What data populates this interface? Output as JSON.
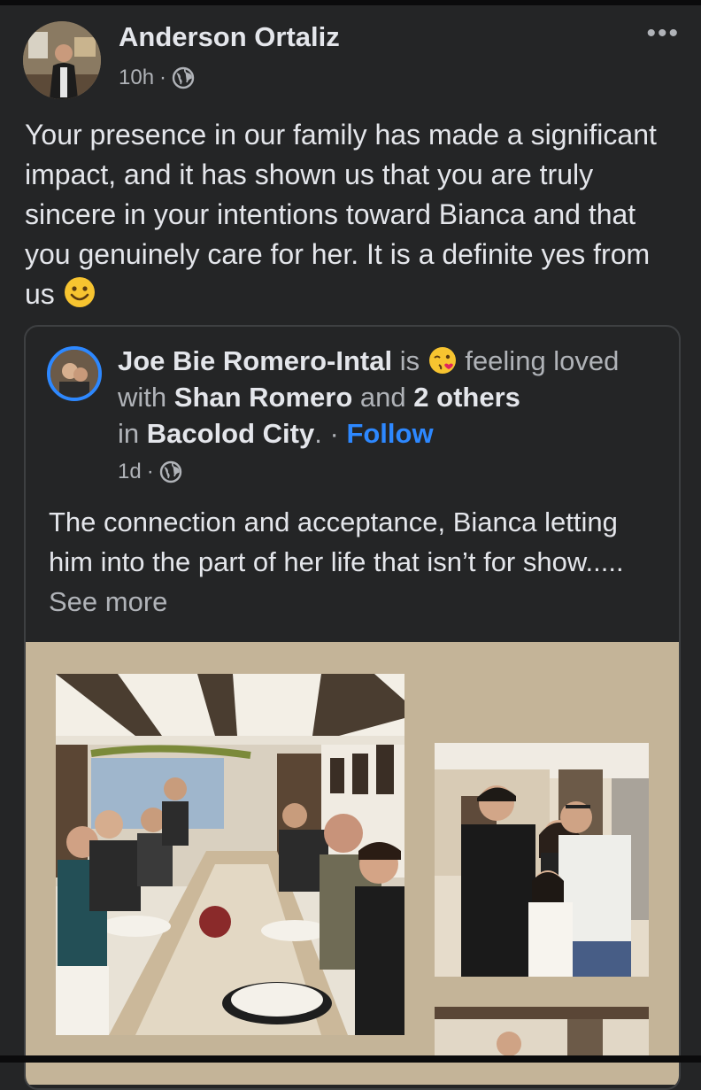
{
  "post": {
    "author": "Anderson Ortaliz",
    "time": "10h",
    "separator": "·",
    "more_label": "•••",
    "caption": "Your presence in our family has made a significant impact, and it has shown us that you are truly sincere in your intentions toward Bianca and that you genuinely care for her. It is a definite yes from us",
    "caption_emoji": "smiling-face-icon"
  },
  "shared": {
    "author": "Joe Bie Romero-Intal",
    "is_text": "is",
    "feeling_emoji": "face-blowing-kiss-icon",
    "feeling_text": "feeling loved with",
    "tagged": "Shan Romero",
    "and_text": "and",
    "others": "2 others",
    "in_text": "in",
    "location": "Bacolod City",
    "period": ".",
    "separator": "·",
    "follow": "Follow",
    "time": "1d",
    "text": "The connection and acceptance, Bianca letting him into the part of her life that isn’t for show.....",
    "see_more": "See more"
  },
  "colors": {
    "background": "#242526",
    "text": "#e4e6eb",
    "secondary_text": "#b0b3b8",
    "link": "#2d88ff",
    "photo_backdrop": "#c4b498"
  }
}
